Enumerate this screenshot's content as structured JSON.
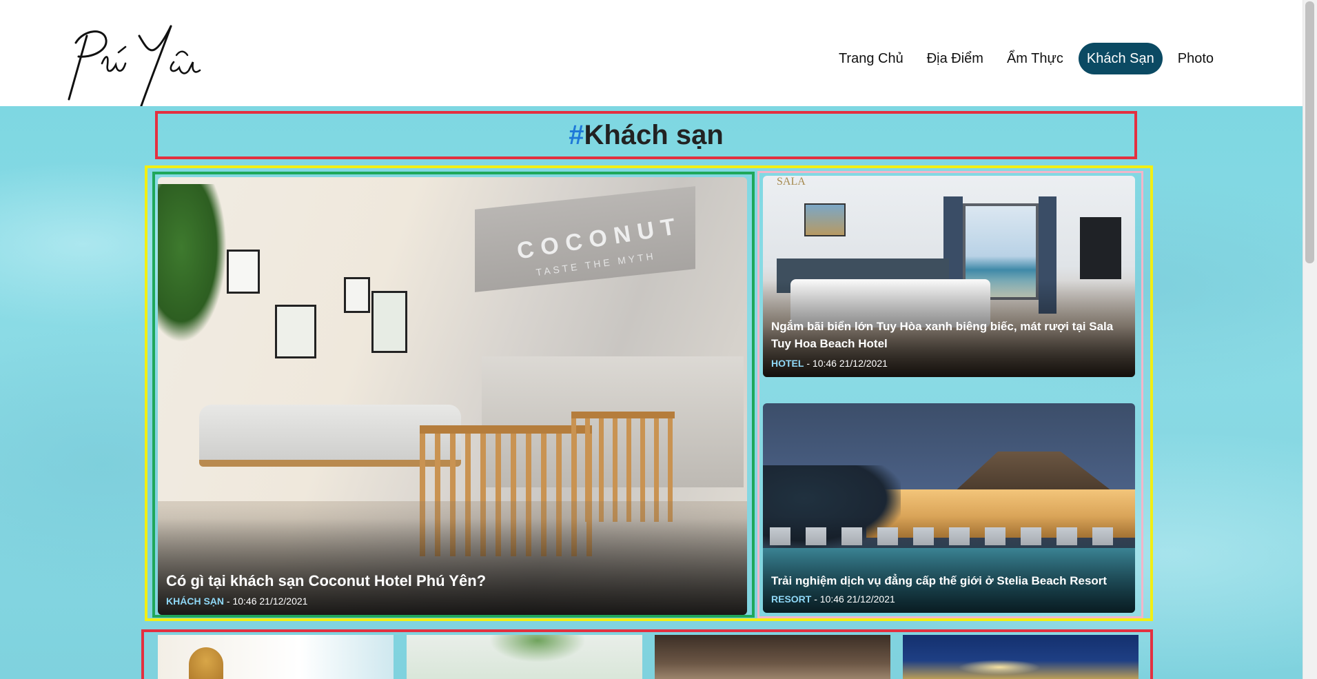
{
  "site": {
    "logo_text": "Phú Yên"
  },
  "nav": {
    "items": [
      {
        "label": "Trang Chủ",
        "active": false
      },
      {
        "label": "Địa Điểm",
        "active": false
      },
      {
        "label": "Ẩm Thực",
        "active": false
      },
      {
        "label": "Khách Sạn",
        "active": true
      },
      {
        "label": "Photo",
        "active": false
      }
    ]
  },
  "page": {
    "hash": "#",
    "title": "Khách sạn"
  },
  "featured": {
    "main": {
      "image_label": "COCONUT",
      "image_sublabel": "TASTE THE MYTH",
      "title": "Có gì tại khách sạn Coconut Hotel Phú Yên?",
      "category": "KHÁCH SẠN",
      "sep": " - ",
      "date": "10:46 21/12/2021"
    },
    "side": [
      {
        "image_label": "SALA",
        "title": "Ngắm bãi biển lớn Tuy Hòa xanh biêng biếc, mát rượi tại Sala Tuy Hoa Beach Hotel",
        "category": "HOTEL",
        "sep": " - ",
        "date": "10:46 21/12/2021"
      },
      {
        "title": "Trải nghiệm dịch vụ đẳng cấp thế giới ở Stelia Beach Resort",
        "category": "RESORT",
        "sep": " - ",
        "date": "10:46 21/12/2021"
      }
    ]
  },
  "colors": {
    "nav_active": "#0b4a63",
    "hash": "#1e78d8",
    "category": "#8fd8f7",
    "frame_red": "#e33040",
    "frame_yellow": "#f2ef12",
    "frame_green": "#1fa75a",
    "frame_pink": "#f2b6c9"
  }
}
